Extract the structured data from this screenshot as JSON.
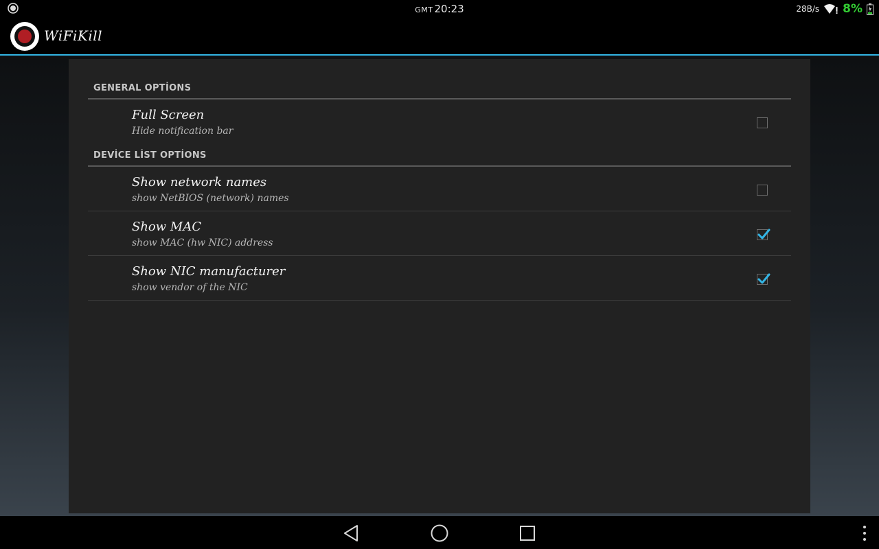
{
  "status_bar": {
    "timezone": "GMT",
    "time": "20:23",
    "speed": "28B/s",
    "battery_percent": "8%",
    "icons": [
      "app-notification-icon",
      "wifi-icon",
      "battery-icon"
    ],
    "battery_color": "#33cc33"
  },
  "action_bar": {
    "title": "WiFiKill",
    "logo": "wifikill-logo-icon",
    "accent_color": "#33b5e5"
  },
  "sections": [
    {
      "header": "GENERAL OPTİONS",
      "items": [
        {
          "title": "Full Screen",
          "summary": "Hide notification bar",
          "checked": false
        }
      ]
    },
    {
      "header": "DEVİCE LİST OPTİONS",
      "items": [
        {
          "title": "Show network names",
          "summary": "show NetBIOS (network) names",
          "checked": false
        },
        {
          "title": "Show MAC",
          "summary": "show MAC (hw NIC) address",
          "checked": true
        },
        {
          "title": "Show NIC manufacturer",
          "summary": "show vendor of the NIC",
          "checked": true
        }
      ]
    }
  ],
  "nav_bar": {
    "icons": [
      "back-icon",
      "home-icon",
      "recent-apps-icon",
      "overflow-menu-icon"
    ]
  },
  "colors": {
    "check_accent": "#33b5e5"
  }
}
